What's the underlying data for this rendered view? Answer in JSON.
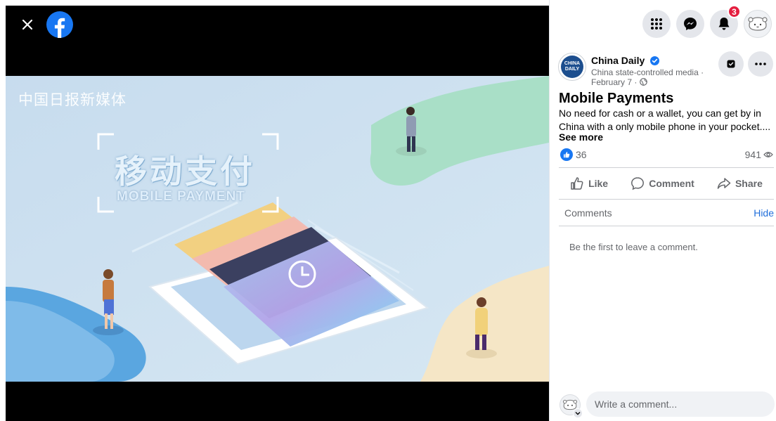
{
  "video": {
    "watermark": "中国日报新媒体",
    "title_zh": "移动支付",
    "title_en": "MOBILE PAYMENT",
    "colors": {
      "bg": "#cfe3f1",
      "green": "#9fdcc4",
      "cream": "#f6e8c9",
      "blue": "#5aa6e0"
    }
  },
  "topbar": {
    "notification_count": "3"
  },
  "post": {
    "page_name": "China Daily",
    "page_avatar_text_1": "CHINA",
    "page_avatar_text_2": "DAILY",
    "subtitle": "China state-controlled media ·",
    "date": "February 7 ·",
    "title": "Mobile Payments",
    "body": "No need for cash or a wallet, you can get by in China with a only mobile phone in your pocket....",
    "see_more": "See more",
    "likes": "36",
    "views": "941"
  },
  "actions": {
    "like": "Like",
    "comment": "Comment",
    "share": "Share"
  },
  "comments": {
    "header": "Comments",
    "hide": "Hide",
    "empty": "Be the first to leave a comment.",
    "placeholder": "Write a comment..."
  },
  "colors": {
    "accent": "#1877f2",
    "badge": "#e41e3f",
    "link": "#216fdb",
    "muted": "#65676b"
  }
}
